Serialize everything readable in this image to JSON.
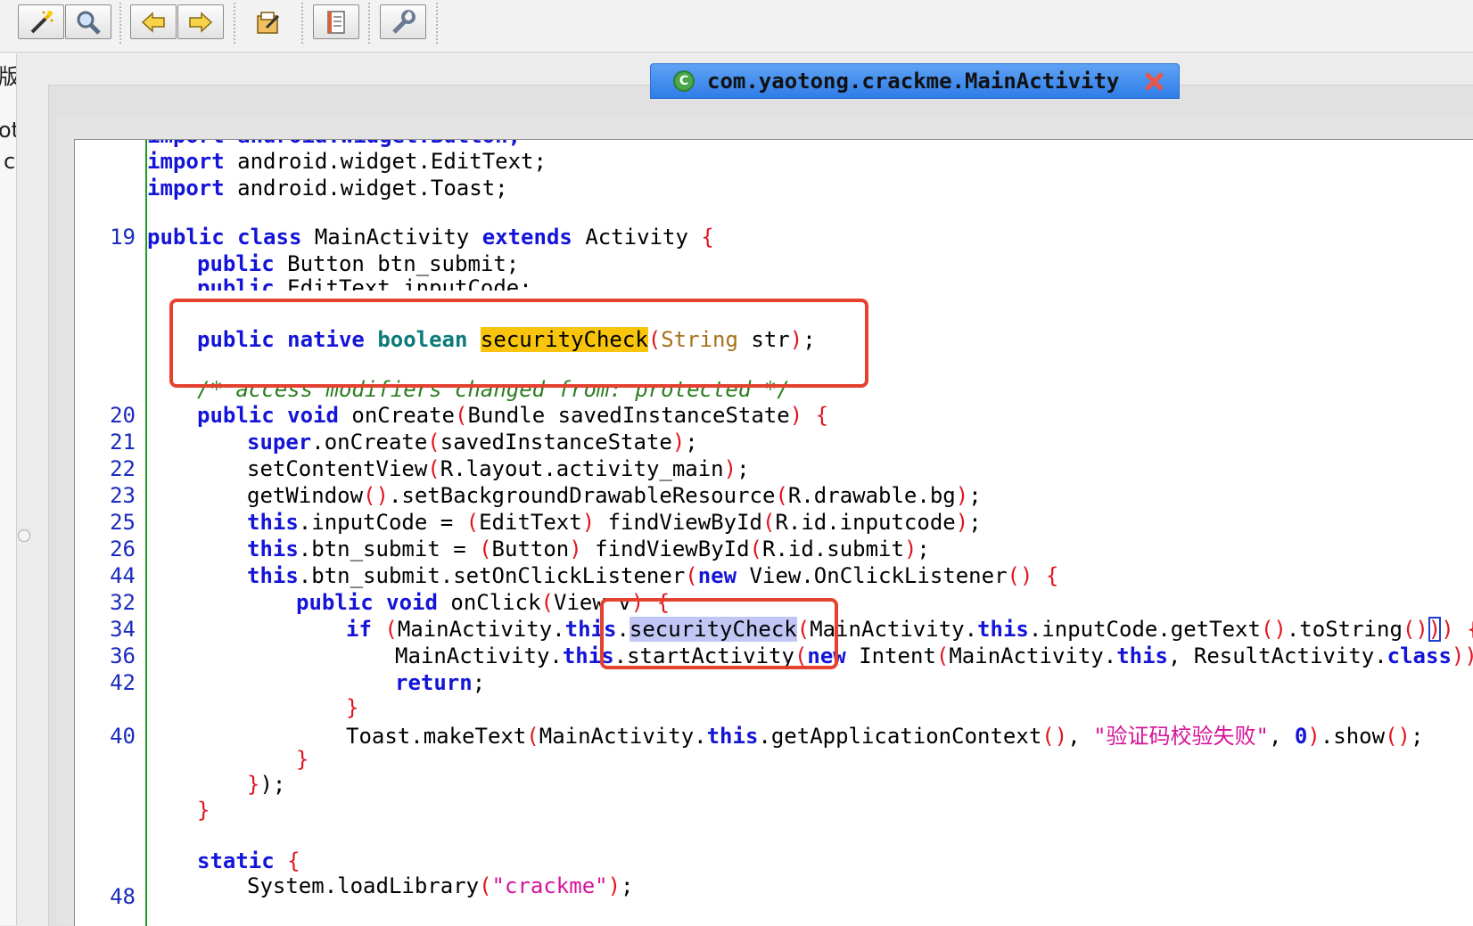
{
  "toolbar": {
    "buttons": [
      {
        "name": "magic-wand-icon"
      },
      {
        "name": "search-icon"
      },
      {
        "name": "back-arrow-icon"
      },
      {
        "name": "forward-arrow-icon"
      },
      {
        "name": "edit-document-icon"
      },
      {
        "name": "log-document-icon"
      },
      {
        "name": "settings-wrench-icon"
      }
    ]
  },
  "left_strip": {
    "chars": [
      "版",
      "ot",
      "c"
    ]
  },
  "tab": {
    "title": "com.yaotong.crackme.MainActivity",
    "icon": "class-icon",
    "icon_letter": "C",
    "close": "close-icon"
  },
  "colors": {
    "keyword": "#1414d8",
    "paren": "#e0141e",
    "string": "#d4149a",
    "comment": "#2a7d1e",
    "highlight": "#f8c40c",
    "annotation_box": "#e5412f",
    "tab": "#3a86ee"
  },
  "code": {
    "line_numbers": [
      "19",
      "20",
      "21",
      "22",
      "23",
      "25",
      "26",
      "44",
      "32",
      "34",
      "36",
      "42",
      "40",
      "48"
    ],
    "imports": {
      "kw": "import",
      "partial_line": "import android.widget.Button;",
      "edittext": "android.widget.EditText;",
      "toast": "android.widget.Toast;"
    },
    "class_decl": {
      "public": "public",
      "class": "class",
      "name": "MainActivity",
      "extends": "extends",
      "parent": "Activity"
    },
    "field1": {
      "kw": "public",
      "rest": "Button btn_submit;"
    },
    "field2": {
      "kw": "public",
      "rest": "EditText inputCode;"
    },
    "native_decl": {
      "public": "public",
      "native": "native",
      "type": "boolean",
      "method": "securityCheck",
      "param_type": "String",
      "param": "str"
    },
    "comment": "/* access modifiers changed from: protected */",
    "oncreate": {
      "public": "public",
      "void": "void",
      "sig": "onCreate",
      "param": "Bundle savedInstanceState"
    },
    "super_call": {
      "kw": "super",
      "rest": ".onCreate",
      "arg": "savedInstanceState"
    },
    "setcontent": {
      "fn": "setContentView",
      "arg": "R.layout.activity_main"
    },
    "getwindow": {
      "fn": "getWindow",
      "mid": ".setBackgroundDrawableResource",
      "arg": "R.drawable.bg"
    },
    "inputcode_assign": {
      "this": "this",
      "lhs": ".inputCode = ",
      "cast": "EditText",
      "fn": " findViewById",
      "arg": "R.id.inputcode"
    },
    "btn_assign": {
      "this": "this",
      "lhs": ".btn_submit = ",
      "cast": "Button",
      "fn": " findViewById",
      "arg": "R.id.submit"
    },
    "listener": {
      "this": "this",
      "lhs": ".btn_submit.setOnClickListener",
      "new": "new",
      "cls": " View.OnClickListener"
    },
    "onclick": {
      "public": "public",
      "void": "void",
      "name": " onClick",
      "param": "View v"
    },
    "if_line": {
      "if": "if",
      "a": "MainActivity.",
      "this": "this",
      "dot": ".",
      "method": "securityCheck",
      "b": "MainActivity.",
      "this2": "this",
      "c": ".inputCode.getText",
      "d": ".toString"
    },
    "start_line": {
      "a": "MainActivity.",
      "this": "this",
      "b": ".startActivity",
      "new": "new",
      "c": " Intent",
      "d": "MainActivity.",
      "this2": "this",
      "e": ", ResultActivity.",
      "class": "class"
    },
    "return_kw": "return",
    "toast_line": {
      "a": "Toast.makeText",
      "b": "MainActivity.",
      "this": "this",
      "c": ".getApplicationContext",
      "str": "\"验证码校验失败\"",
      "num": "0",
      "d": ".show"
    },
    "static_kw": "static",
    "load_line": {
      "a": "System.loadLibrary",
      "str": "\"crackme\""
    }
  }
}
